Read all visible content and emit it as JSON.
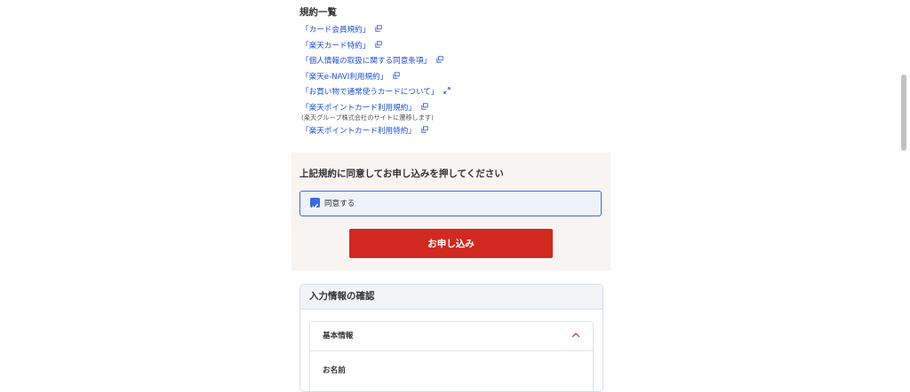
{
  "terms": {
    "heading": "規約一覧",
    "links": [
      {
        "label": "「カード会員規約」",
        "icon": "external-window-icon"
      },
      {
        "label": "「楽天カード特約」",
        "icon": "external-window-icon"
      },
      {
        "label": "「個人情報の取扱に関する同意条項」",
        "icon": "external-window-icon"
      },
      {
        "label": "「楽天e-NAVI利用規約」",
        "icon": "external-window-icon"
      },
      {
        "label": "「お買い物で通常使うカードについて」",
        "icon": "expand-icon"
      },
      {
        "label": "「楽天ポイントカード利用規約」",
        "icon": "external-window-icon",
        "note": "(楽天グループ株式会社のサイトに遷移します)"
      },
      {
        "label": "「楽天ポイントカード利用特約」",
        "icon": "external-window-icon"
      }
    ]
  },
  "agreement": {
    "title": "上記規約に同意してお申し込みを押してください",
    "checkbox_label": "同意する",
    "checked": true,
    "submit_label": "お申し込み"
  },
  "confirm": {
    "title": "入力情報の確認",
    "section_title": "基本情報",
    "field_label": "お名前"
  },
  "colors": {
    "link": "#1d4ed8",
    "accent_red": "#d1281f",
    "check_blue": "#3a6bdf",
    "panel_bg": "#f8f4f2"
  }
}
